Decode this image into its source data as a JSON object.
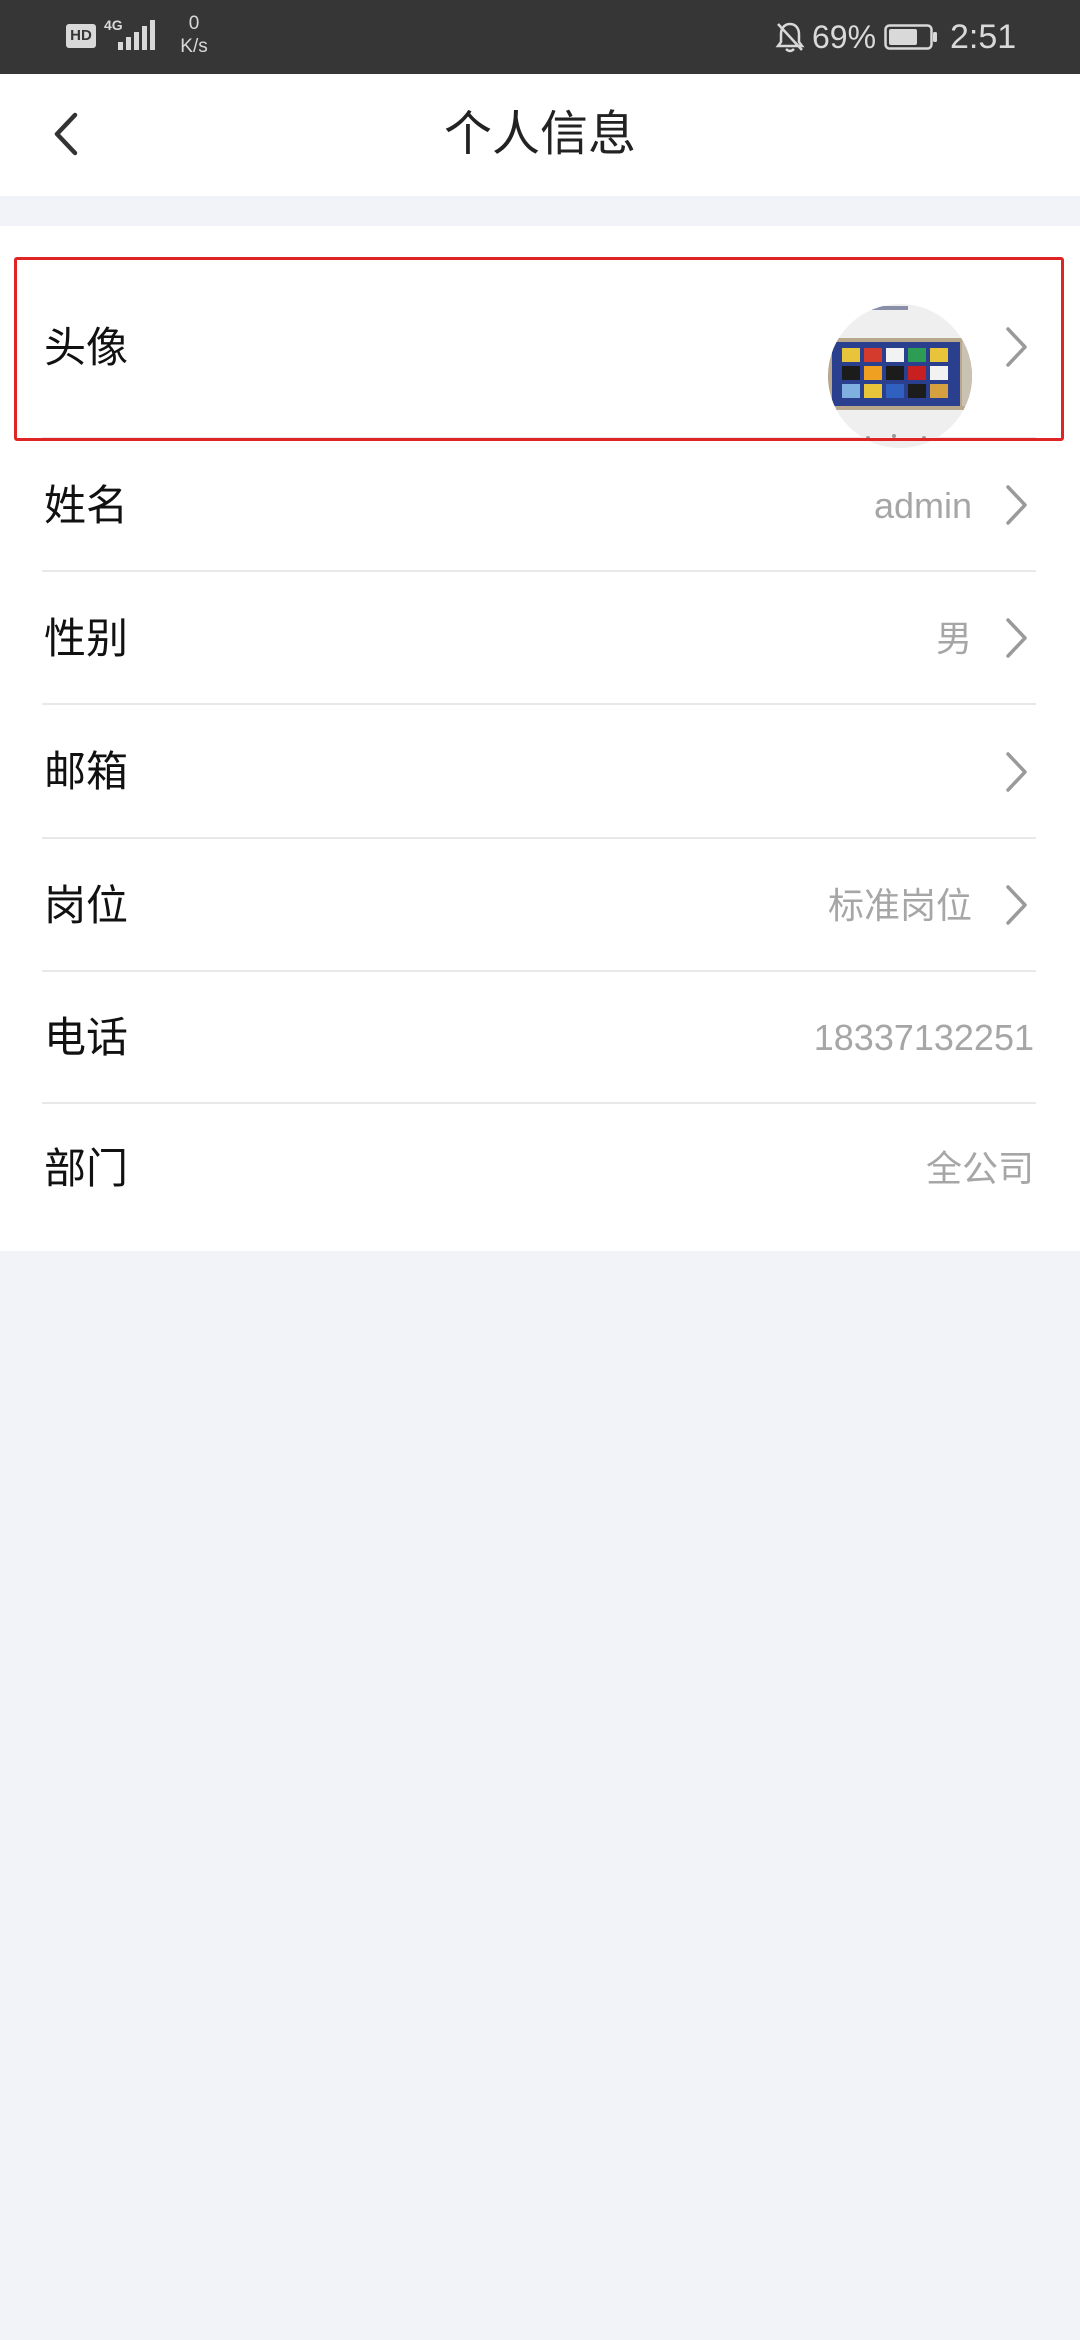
{
  "status_bar": {
    "hd_badge": "HD",
    "network_type": "4G",
    "speed_value": "0",
    "speed_unit": "K/s",
    "battery_percent": "69%",
    "time": "2:51",
    "icons": [
      "signal-icon",
      "bell-off-icon",
      "battery-icon"
    ]
  },
  "header": {
    "title": "个人信息",
    "back_icon": "chevron-left-icon"
  },
  "profile": {
    "rows": [
      {
        "label": "头像",
        "value": "",
        "has_chevron": true,
        "type": "avatar"
      },
      {
        "label": "姓名",
        "value": "admin",
        "has_chevron": true
      },
      {
        "label": "性别",
        "value": "男",
        "has_chevron": true
      },
      {
        "label": "邮箱",
        "value": "",
        "has_chevron": true
      },
      {
        "label": "岗位",
        "value": "标准岗位",
        "has_chevron": true
      },
      {
        "label": "电话",
        "value": "18337132251",
        "has_chevron": false
      },
      {
        "label": "部门",
        "value": "全公司",
        "has_chevron": false
      }
    ]
  },
  "colors": {
    "status_bar_bg": "#363636",
    "page_bg": "#f2f3f8",
    "highlight": "#e02323",
    "value_text": "#a6a6a6"
  }
}
